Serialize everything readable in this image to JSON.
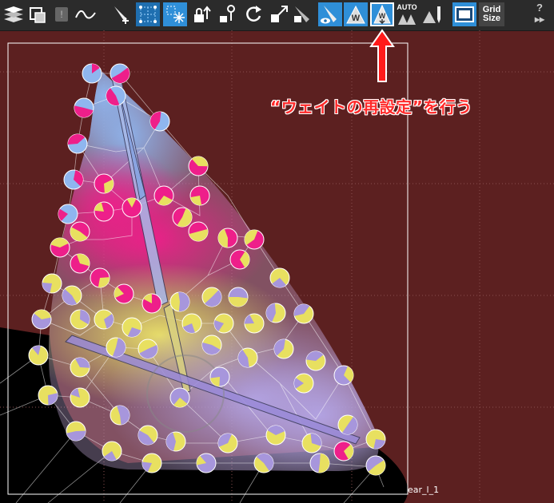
{
  "toolbar": {
    "auto_label": "AUTO",
    "grid_size_line1": "Grid",
    "grid_size_line2": "Size",
    "help_label": "?",
    "more_label": "▸▸"
  },
  "annotation": {
    "text": "“ウェイトの再設定”を行う"
  },
  "viewport": {
    "bone_label": "ear_l_1"
  },
  "colors": {
    "background": "#5c2020",
    "toolbar": "#2b2b2b",
    "active_tool": "#2f8fd8",
    "callout": "#ff2a2a",
    "weight_blue": "#8fb6ef",
    "weight_magenta": "#ee1f8a",
    "weight_yellow": "#e8e060",
    "weight_lavender": "#a796dc"
  }
}
